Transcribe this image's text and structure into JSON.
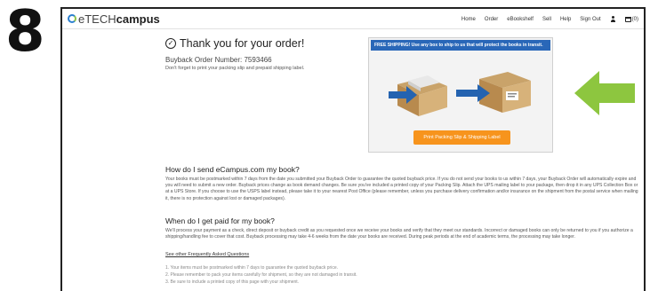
{
  "step": {
    "number": "8"
  },
  "header": {
    "logo_prefix": "e",
    "logo_a": "TECH",
    "logo_b": "campus",
    "nav": [
      "Home",
      "Order",
      "eBookshelf",
      "Sell",
      "Help",
      "Sign Out"
    ],
    "cart_count": "(0)"
  },
  "confirmation": {
    "title": "Thank you for your order!",
    "order_number": "Buyback Order Number: 7593466",
    "reminder": "Don't forget to print your packing slip and prepaid shipping label."
  },
  "promo": {
    "banner": "FREE SHIPPING! Use any box to ship to us that will protect the books in transit.",
    "button_label": "Print Packing Slip & Shipping Label"
  },
  "sections": [
    {
      "heading": "How do I send eCampus.com my book?",
      "body": "Your books must be postmarked within 7 days from the date you submitted your Buyback Order to guarantee the quoted buyback price. If you do not send your books to us within 7 days, your Buyback Order will automatically expire and you will need to submit a new order. Buyback prices change as book demand changes. Be sure you've included a printed copy of your Packing Slip. Attach the UPS mailing label to your package, then drop it in any UPS Collection Box or at a UPS Store. If you choose to use the USPS label instead, please take it to your nearest Post Office (please remember, unless you purchase delivery confirmation and/or insurance on the shipment from the postal service when mailing it, there is no protection against lost or damaged packages)."
    },
    {
      "heading": "When do I get paid for my book?",
      "body": "We'll process your payment as a check, direct deposit or buyback credit as you requested once we receive your books and verify that they meet our standards. Incorrect or damaged books can only be returned to you if you authorize a shipping/handling fee to cover that cost. Buyback processing may take 4-6 weeks from the date your books are received. During peak periods at the end of academic terms, the processing may take longer."
    }
  ],
  "faq_link": "See other Frequently Asked Questions",
  "notes": [
    "1. Your items must be postmarked within 7 days to guarantee the quoted buyback price.",
    "2. Please remember to pack your items carefully for shipment, so they are not damaged in transit.",
    "3. Be sure to include a printed copy of this page with your shipment."
  ],
  "colors": {
    "banner_blue": "#2967b8",
    "button_orange": "#f7941d",
    "arrow_green": "#8dc63f"
  }
}
